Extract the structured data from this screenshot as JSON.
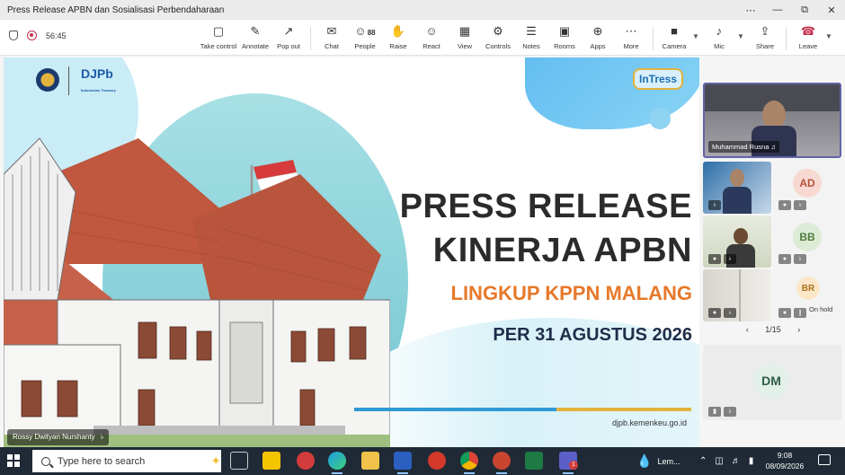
{
  "window": {
    "title": "Press Release APBN dan Sosialisasi Perbendaharaan",
    "controls": [
      "⋯",
      "—",
      "⧉",
      "✕"
    ]
  },
  "toolbar": {
    "timer": "56:45",
    "items": [
      {
        "key": "take_control",
        "label": "Take control",
        "icon": "▢"
      },
      {
        "key": "annotate",
        "label": "Annotate",
        "icon": "✎"
      },
      {
        "key": "pop_out",
        "label": "Pop out",
        "icon": "↗"
      },
      {
        "key": "chat",
        "label": "Chat",
        "icon": "✉"
      },
      {
        "key": "people",
        "label": "People",
        "icon": "☺",
        "count": "88"
      },
      {
        "key": "raise",
        "label": "Raise",
        "icon": "✋"
      },
      {
        "key": "react",
        "label": "React",
        "icon": "☺"
      },
      {
        "key": "view",
        "label": "View",
        "icon": "▦"
      },
      {
        "key": "controls",
        "label": "Controls",
        "icon": "⚙"
      },
      {
        "key": "notes",
        "label": "Notes",
        "icon": "☰"
      },
      {
        "key": "rooms",
        "label": "Rooms",
        "icon": "▣"
      },
      {
        "key": "apps",
        "label": "Apps",
        "icon": "⊕"
      },
      {
        "key": "more",
        "label": "More",
        "icon": "⋯"
      },
      {
        "key": "camera",
        "label": "Camera",
        "icon": "■"
      },
      {
        "key": "mic",
        "label": "Mic",
        "icon": "♪"
      },
      {
        "key": "share",
        "label": "Share",
        "icon": "⇪"
      },
      {
        "key": "leave",
        "label": "Leave",
        "icon": "☎"
      }
    ],
    "leave_color": "#c4314b"
  },
  "slide": {
    "org_logo_text": "DJPb",
    "org_logo_subtext": "Indonesian Treasury",
    "brand_badge": "InTress",
    "headline_line1": "PRESS RELEASE",
    "headline_line2": "KINERJA APBN",
    "subheadline": "LINGKUP KPPN MALANG",
    "date_line": "PER 31 AGUSTUS 2026",
    "url": "djpb.kemenkeu.go.id",
    "accent_orange": "#e6792b",
    "accent_blue": "#2f9ad6",
    "accent_gold": "#e3b23c"
  },
  "presenter": {
    "name": "Rossy Dwityan Nurshanty"
  },
  "participants": {
    "main_tile_name": "Muhammad Rusna",
    "tiles": [
      {
        "initials": "AD",
        "color": "#f7d9d2",
        "text_color": "#b5533c"
      },
      {
        "initials": "BB",
        "color": "#dcebd6",
        "text_color": "#4f7a3f"
      },
      {
        "initials": "BR",
        "color": "#fbe6c8",
        "text_color": "#a8731c",
        "label": "On hold"
      },
      {
        "initials": "DM",
        "color": "#e3efe9",
        "text_color": "#2f5d4a"
      }
    ],
    "pager": "1/15"
  },
  "taskbar": {
    "search_placeholder": "Type here to search",
    "weather_label": "Lem...",
    "time": "9:08",
    "date": "08/09/2026",
    "badge": "1"
  }
}
